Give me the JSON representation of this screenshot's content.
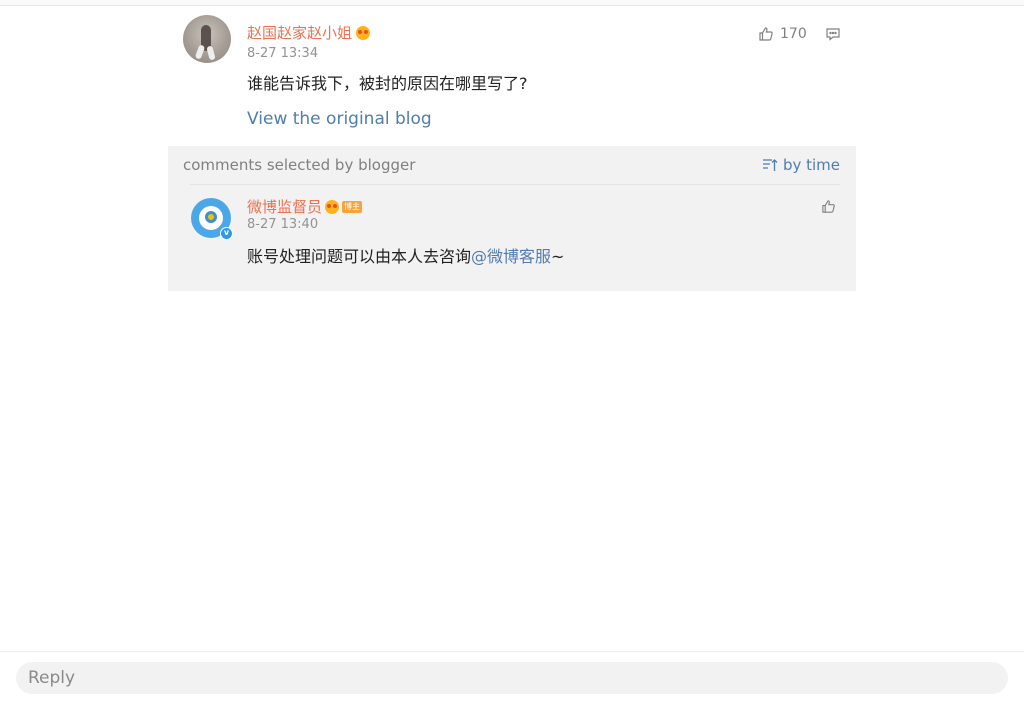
{
  "comment": {
    "username": "赵国赵家赵小姐",
    "time": "8-27 13:34",
    "text": "谁能告诉我下，被封的原因在哪里写了?",
    "view_link": "View the original blog",
    "like_count": "170"
  },
  "selected_section": {
    "title": "comments selected by blogger",
    "sort_label": "by time",
    "reply": {
      "username": "微博监督员",
      "tag": "博主",
      "time": "8-27 13:40",
      "text": "账号处理问题可以由本人去咨询",
      "mention": "@微博客服",
      "suffix": "~"
    }
  },
  "reply_bar": {
    "placeholder": "Reply"
  },
  "colors": {
    "username": "#eb7350",
    "link": "#507daf",
    "meta": "#939393"
  },
  "icons": [
    "thumbs-up-icon",
    "comment-icon",
    "sort-icon",
    "vip-icon",
    "verified-icon"
  ]
}
